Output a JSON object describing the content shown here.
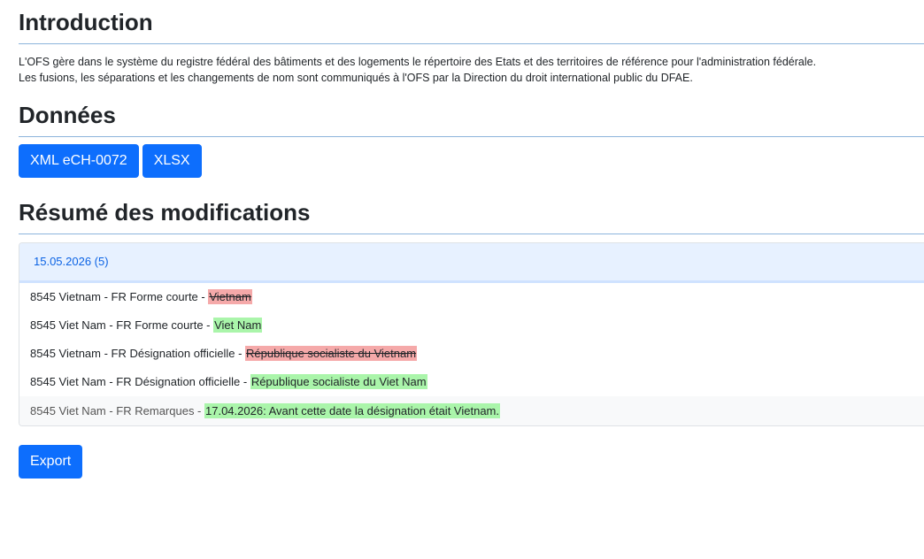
{
  "intro": {
    "title": "Introduction",
    "line1": "L'OFS gère dans le système du registre fédéral des bâtiments et des logements le répertoire des Etats et des territoires de référence pour l'administration fédérale.",
    "line2": "Les fusions, les séparations et les changements de nom sont communiqués à l'OFS par la Direction du droit international public du DFAE."
  },
  "data_section": {
    "title": "Données",
    "buttons": [
      "XML eCH-0072",
      "XLSX"
    ]
  },
  "changes": {
    "title": "Résumé des modifications",
    "accordion_header": "15.05.2026 (5)",
    "rows": [
      {
        "prefix": "8545 Vietnam - FR Forme courte - ",
        "value": "Vietnam",
        "kind": "old"
      },
      {
        "prefix": "8545 Viet Nam - FR Forme courte - ",
        "value": "Viet Nam",
        "kind": "new"
      },
      {
        "prefix": "8545 Vietnam - FR Désignation officielle - ",
        "value": "République socialiste du Vietnam",
        "kind": "old"
      },
      {
        "prefix": "8545 Viet Nam - FR Désignation officielle - ",
        "value": "République socialiste du Viet Nam",
        "kind": "new"
      },
      {
        "prefix": "8545 Viet Nam - FR Remarques - ",
        "value": "17.04.2026: Avant cette date la désignation était Vietnam.",
        "kind": "new"
      }
    ]
  },
  "export": {
    "label": "Export"
  },
  "colors": {
    "primary": "#0d6efd",
    "rule": "#8cb4dc",
    "accordion_bg": "#e7f1ff",
    "removed": "#f5a9a9",
    "added": "#aaf5aa"
  }
}
